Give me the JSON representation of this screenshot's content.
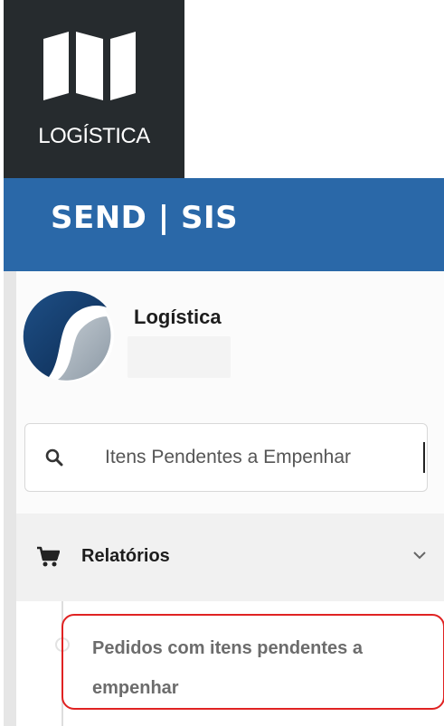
{
  "tile": {
    "label": "LOGÍSTICA",
    "icon": "map-icon"
  },
  "header": {
    "brand": "SEND | SIS",
    "color": "#2a68a8"
  },
  "profile": {
    "name": "Logística",
    "avatar": "company-logo"
  },
  "search": {
    "value": "Itens Pendentes a Empenhar",
    "icon": "search-icon"
  },
  "menu": {
    "section_label": "Relatórios",
    "section_icon": "cart-icon",
    "expanded": true,
    "items": [
      {
        "label": "Pedidos com itens pendentes a empenhar",
        "highlighted": true
      }
    ]
  },
  "colors": {
    "tile_bg": "#262b2e",
    "highlight": "#e02222"
  }
}
